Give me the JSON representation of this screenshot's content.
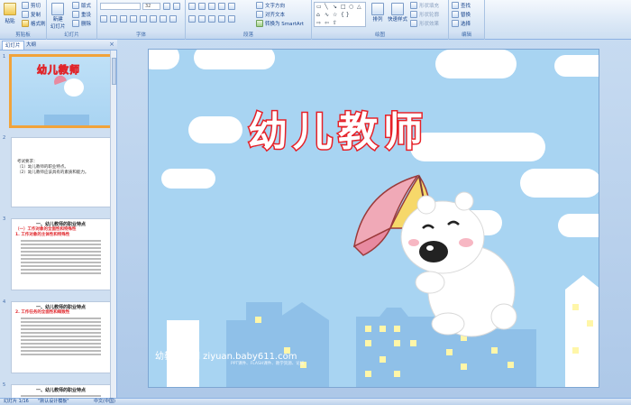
{
  "ribbon": {
    "groups": [
      {
        "label": "剪贴板"
      },
      {
        "label": "幻灯片"
      },
      {
        "label": "字体"
      },
      {
        "label": "段落"
      },
      {
        "label": "绘图"
      },
      {
        "label": "编辑"
      }
    ],
    "paste": "粘贴",
    "cut": "剪切",
    "copy": "复制",
    "format_painter": "格式刷",
    "new_slide": "新建",
    "new_slide2": "幻灯片",
    "layout": "版式",
    "reset": "重设",
    "delete": "删除",
    "font_size": "32",
    "text_direction": "文字方向",
    "align_text": "对齐文本",
    "smartart": "转换为 SmartArt",
    "arrange": "排列",
    "quick_styles": "快速样式",
    "shape_fill": "形状填充",
    "shape_outline": "形状轮廓",
    "shape_effects": "形状效果",
    "find": "查找",
    "replace": "替换",
    "select": "选择"
  },
  "pane": {
    "tab_slides": "幻灯片",
    "tab_outline": "大纲",
    "close": "×",
    "slides": [
      {
        "num": "1",
        "title": "幼儿教师"
      },
      {
        "num": "2",
        "lines": [
          "考试要求：",
          "（1）幼儿教师的职业特点。",
          "（2）幼儿教师应该具有的素质和能力。"
        ]
      },
      {
        "num": "3",
        "heading": "一、幼儿教师的职业特点",
        "sub1": "（一）工作对象的全面性和特殊性",
        "sub2": "1. 工作对象的主体性和特殊性"
      },
      {
        "num": "4",
        "heading": "一、幼儿教师的职业特点",
        "sub1": "2. 工作任务的全面性和细致性"
      },
      {
        "num": "5",
        "heading": "一、幼儿教师的职业特点"
      }
    ]
  },
  "slide": {
    "title": "幼儿教师",
    "watermark": "幼教资源网 ziyuan.baby611.com",
    "watermark_sub": "PPT课件、FLASH课件、教学资源、论坛"
  },
  "status": {
    "slide_of": "幻灯片 1/16",
    "theme": "\"默认设计模板\"",
    "language": "中文(中国)"
  }
}
